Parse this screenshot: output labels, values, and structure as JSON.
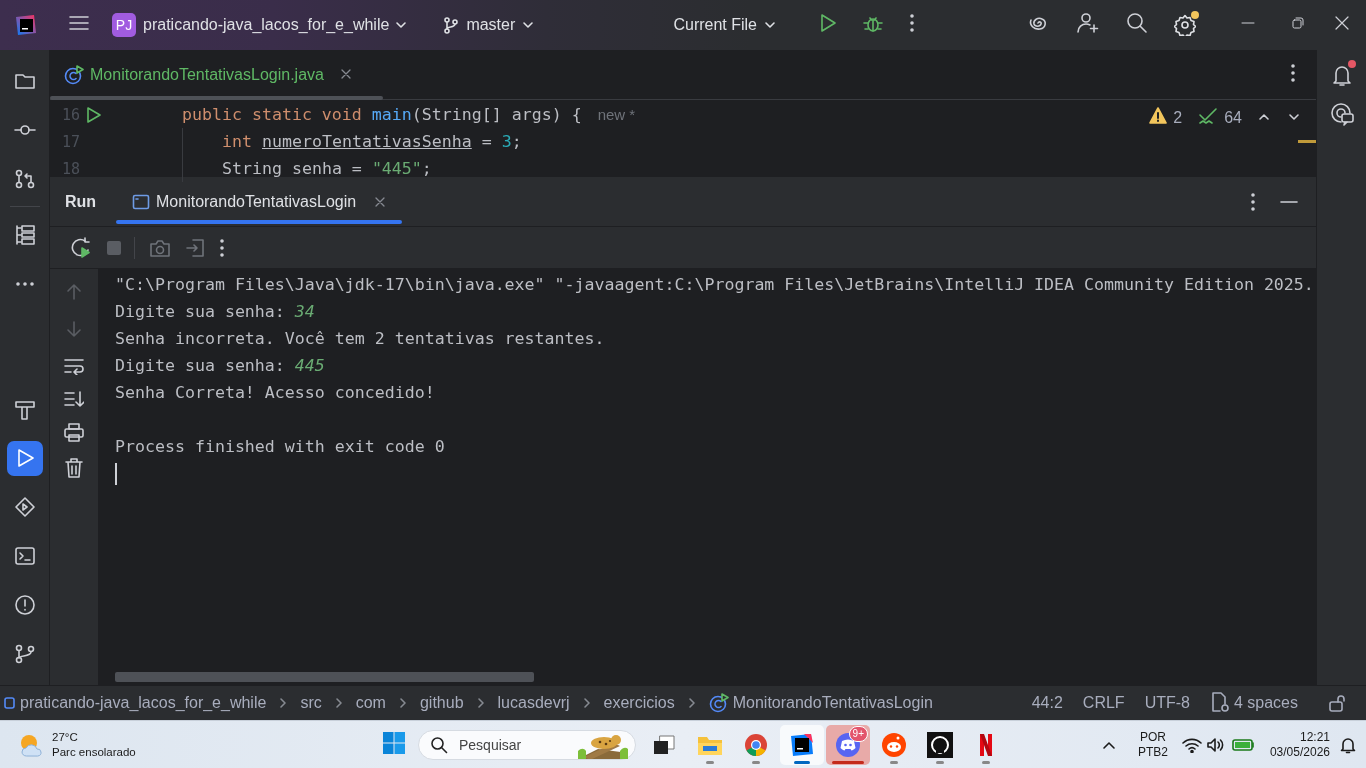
{
  "title_bar": {
    "project_badge": "PJ",
    "project": "praticando-java_lacos_for_e_while",
    "branch": "master",
    "run_config": "Current File",
    "settings_update": true
  },
  "left_tools": [
    {
      "kind": "project",
      "selected": false
    },
    {
      "kind": "commit",
      "selected": false
    },
    {
      "kind": "pull-requests",
      "selected": false
    },
    {
      "kind": "structure",
      "selected": false
    },
    {
      "kind": "more",
      "selected": false
    },
    {
      "kind": "build",
      "selected": false
    },
    {
      "kind": "run",
      "selected": true
    },
    {
      "kind": "services",
      "selected": false
    },
    {
      "kind": "terminal",
      "selected": false
    },
    {
      "kind": "problems",
      "selected": false
    },
    {
      "kind": "git",
      "selected": false
    }
  ],
  "right_tools": {
    "notifications_unread": true
  },
  "editor": {
    "tabs": [
      {
        "label": "MonitorandoTentativasLogin.java",
        "selected": true,
        "new_file": true
      }
    ],
    "lines": [
      {
        "number": "16",
        "runnable": true,
        "tokens": [
          {
            "kind": "keyword",
            "text": "public static void"
          },
          {
            "kind": "method",
            "text": "main"
          },
          {
            "kind": "params",
            "text": "(String[] args) {"
          },
          {
            "kind": "hint",
            "text": "new *"
          }
        ],
        "children": [
          {
            "number": "17",
            "runnable": false,
            "tokens": [
              {
                "kind": "keyword",
                "text": "int"
              },
              {
                "kind": "variable",
                "text": "numeroTentativasSenha"
              },
              {
                "kind": "plain",
                "text": "="
              },
              {
                "kind": "number",
                "text": "3"
              },
              {
                "kind": "punctuation",
                "text": ";"
              }
            ]
          },
          {
            "number": "18",
            "runnable": false,
            "tokens": [
              {
                "kind": "plain",
                "text": "String senha ="
              },
              {
                "kind": "string",
                "text": "\"445\""
              },
              {
                "kind": "punctuation",
                "text": ";"
              }
            ]
          }
        ]
      }
    ],
    "warnings": "2",
    "checks": "64"
  },
  "run_panel": {
    "title": "Run",
    "tabs": [
      {
        "label": "MonitorandoTentativasLogin",
        "selected": true
      }
    ],
    "console": [
      {
        "kind": "text",
        "parts": [
          {
            "kind": "output",
            "text": "\"C:\\Program Files\\Java\\jdk-17\\bin\\java.exe\" \"-javaagent:C:\\Program Files\\JetBrains\\IntelliJ IDEA Community Edition 2025."
          }
        ]
      },
      {
        "kind": "text",
        "parts": [
          {
            "kind": "output",
            "text": "Digite sua senha:"
          },
          {
            "kind": "input",
            "text": "34"
          }
        ]
      },
      {
        "kind": "text",
        "parts": [
          {
            "kind": "output",
            "text": "Senha incorreta. Você tem 2 tentativas restantes."
          }
        ]
      },
      {
        "kind": "text",
        "parts": [
          {
            "kind": "output",
            "text": "Digite sua senha:"
          },
          {
            "kind": "input",
            "text": "445"
          }
        ]
      },
      {
        "kind": "text",
        "parts": [
          {
            "kind": "output",
            "text": "Senha Correta! Acesso concedido!"
          }
        ]
      },
      {
        "kind": "blank"
      },
      {
        "kind": "text",
        "parts": [
          {
            "kind": "output",
            "text": "Process finished with exit code 0"
          }
        ]
      }
    ]
  },
  "status_bar": {
    "breadcrumbs": [
      {
        "kind": "module",
        "text": "praticando-java_lacos_for_e_while"
      },
      {
        "kind": "folder",
        "text": "src"
      },
      {
        "kind": "folder",
        "text": "com"
      },
      {
        "kind": "folder",
        "text": "github"
      },
      {
        "kind": "folder",
        "text": "lucasdevrj"
      },
      {
        "kind": "folder",
        "text": "exercicios"
      },
      {
        "kind": "class",
        "text": "MonitorandoTentativasLogin"
      }
    ],
    "position": "44:2",
    "line_separator": "CRLF",
    "encoding": "UTF-8",
    "indent": "4 spaces"
  },
  "taskbar": {
    "weather": {
      "temperature": "27°C",
      "condition": "Parc ensolarado"
    },
    "search": {
      "placeholder": "Pesquisar"
    },
    "apps": [
      {
        "kind": "task-view",
        "running": false,
        "selected": false,
        "attention": false
      },
      {
        "kind": "files",
        "running": true,
        "selected": false,
        "attention": false
      },
      {
        "kind": "browser",
        "running": true,
        "selected": false,
        "attention": false
      },
      {
        "kind": "ide",
        "running": true,
        "selected": true,
        "attention": false
      },
      {
        "kind": "chat",
        "running": true,
        "selected": false,
        "attention": true,
        "badge": "9+"
      },
      {
        "kind": "forum",
        "running": true,
        "selected": false,
        "attention": false
      },
      {
        "kind": "code-host",
        "running": true,
        "selected": false,
        "attention": false
      },
      {
        "kind": "streaming",
        "running": true,
        "selected": false,
        "attention": false
      }
    ],
    "language": "POR",
    "layout": "PTB2",
    "time": "12:21",
    "date": "03/05/2026"
  }
}
